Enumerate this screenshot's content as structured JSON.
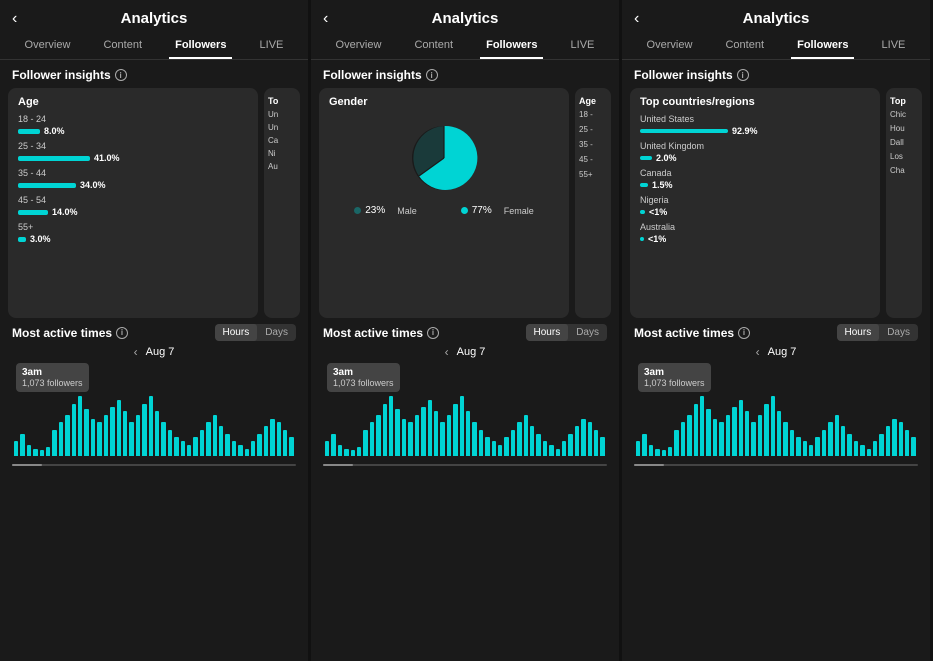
{
  "panels": [
    {
      "id": "panel1",
      "header": {
        "title": "Analytics",
        "back": "‹"
      },
      "nav": {
        "tabs": [
          "Overview",
          "Content",
          "Followers",
          "LIVE"
        ],
        "active": "Followers"
      },
      "follower_insights_label": "Follower insights",
      "cards": [
        {
          "type": "age",
          "title": "Age",
          "rows": [
            {
              "label": "18 - 24",
              "pct": "8.0%",
              "width": 22
            },
            {
              "label": "25 - 34",
              "pct": "41.0%",
              "width": 80
            },
            {
              "label": "35 - 44",
              "pct": "34.0%",
              "width": 66
            },
            {
              "label": "45 - 54",
              "pct": "14.0%",
              "width": 34
            },
            {
              "label": "55+",
              "pct": "3.0%",
              "width": 10
            }
          ]
        },
        {
          "type": "partial",
          "lines": [
            "Un",
            "Un",
            "Ca",
            "Ni",
            "Au"
          ]
        }
      ],
      "active_times": {
        "label": "Most active times",
        "toggle": [
          "Hours",
          "Days"
        ],
        "active_toggle": "Hours",
        "date_nav": {
          "prev": "‹",
          "date": "Aug 7"
        },
        "tooltip": {
          "time": "3am",
          "followers": "1,073 followers"
        },
        "bars": [
          8,
          12,
          6,
          4,
          3,
          5,
          14,
          18,
          22,
          28,
          32,
          25,
          20,
          18,
          22,
          26,
          30,
          24,
          18,
          22,
          28,
          32,
          24,
          18,
          14,
          10,
          8,
          6,
          10,
          14,
          18,
          22,
          16,
          12,
          8,
          6,
          4,
          8,
          12,
          16,
          20,
          18,
          14,
          10
        ]
      }
    },
    {
      "id": "panel2",
      "header": {
        "title": "Analytics",
        "back": "‹"
      },
      "nav": {
        "tabs": [
          "Overview",
          "Content",
          "Followers",
          "LIVE"
        ],
        "active": "Followers"
      },
      "follower_insights_label": "Follower insights",
      "cards": [
        {
          "type": "gender",
          "title": "Gender",
          "male_pct": "23%",
          "female_pct": "77%",
          "male_label": "Male",
          "female_label": "Female"
        },
        {
          "type": "partial_age",
          "title": "Age",
          "lines": [
            "18 -",
            "25 -",
            "35 -",
            "45 -",
            "55+"
          ]
        }
      ],
      "active_times": {
        "label": "Most active times",
        "toggle": [
          "Hours",
          "Days"
        ],
        "active_toggle": "Hours",
        "date_nav": {
          "prev": "‹",
          "date": "Aug 7"
        },
        "tooltip": {
          "time": "3am",
          "followers": "1,073 followers"
        },
        "bars": [
          8,
          12,
          6,
          4,
          3,
          5,
          14,
          18,
          22,
          28,
          32,
          25,
          20,
          18,
          22,
          26,
          30,
          24,
          18,
          22,
          28,
          32,
          24,
          18,
          14,
          10,
          8,
          6,
          10,
          14,
          18,
          22,
          16,
          12,
          8,
          6,
          4,
          8,
          12,
          16,
          20,
          18,
          14,
          10
        ]
      }
    },
    {
      "id": "panel3",
      "header": {
        "title": "Analytics",
        "back": "‹"
      },
      "nav": {
        "tabs": [
          "Overview",
          "Content",
          "Followers",
          "LIVE"
        ],
        "active": "Followers"
      },
      "follower_insights_label": "Follower insights",
      "cards": [
        {
          "type": "countries",
          "title": "Top countries/regions",
          "rows": [
            {
              "name": "United States",
              "pct": "92.9%",
              "width": 90
            },
            {
              "name": "United Kingdom",
              "pct": "2.0%",
              "width": 12
            },
            {
              "name": "Canada",
              "pct": "1.5%",
              "width": 9
            },
            {
              "name": "Nigeria",
              "pct": "<1%",
              "width": 5
            },
            {
              "name": "Australia",
              "pct": "<1%",
              "width": 4
            }
          ]
        },
        {
          "type": "partial_cities",
          "title": "Top",
          "lines": [
            "Chic",
            "Hou",
            "Dall",
            "Los",
            "Cha"
          ]
        }
      ],
      "active_times": {
        "label": "Most active times",
        "toggle": [
          "Hours",
          "Days"
        ],
        "active_toggle": "Hours",
        "date_nav": {
          "prev": "‹",
          "date": "Aug 7"
        },
        "tooltip": {
          "time": "3am",
          "followers": "1,073 followers"
        },
        "bars": [
          8,
          12,
          6,
          4,
          3,
          5,
          14,
          18,
          22,
          28,
          32,
          25,
          20,
          18,
          22,
          26,
          30,
          24,
          18,
          22,
          28,
          32,
          24,
          18,
          14,
          10,
          8,
          6,
          10,
          14,
          18,
          22,
          16,
          12,
          8,
          6,
          4,
          8,
          12,
          16,
          20,
          18,
          14,
          10
        ]
      }
    }
  ],
  "icons": {
    "info": "i",
    "back": "‹"
  }
}
